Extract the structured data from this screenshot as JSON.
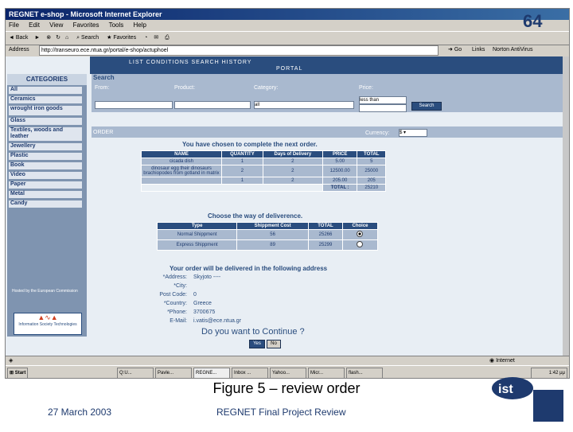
{
  "slide_number": "64",
  "browser": {
    "title": "REGNET e-shop - Microsoft Internet Explorer",
    "menu": [
      "File",
      "Edit",
      "View",
      "Favorites",
      "Tools",
      "Help"
    ],
    "toolbar": {
      "back": "Back",
      "search": "Search",
      "favorites": "Favorites"
    },
    "address_label": "Address",
    "address_value": "http://transeuro.ece.ntua.gr/portal/e-shop/actuphoel",
    "go_label": "Go",
    "links_label": "Links",
    "norton_label": "Norton AntiVirus",
    "status_right": "Internet"
  },
  "page": {
    "nav_links": "LIST   CONDITIONS   SEARCH   HISTORY",
    "nav_active": "PORTAL",
    "categories_title": "CATEGORIES",
    "categories": [
      "All",
      "Ceramics",
      "wrought iron goods",
      "Glass",
      "Textiles, woods and leather",
      "Jewellery",
      "Plastic",
      "Book",
      "Video",
      "Paper",
      "Metal",
      "Candy"
    ],
    "search": {
      "heading": "Search",
      "labels": {
        "from": "From:",
        "product": "Product:",
        "category": "Category:",
        "price": "Price:"
      },
      "category_value": "all",
      "price_value": "less than",
      "button": "Search"
    },
    "order": {
      "heading": "ORDER",
      "currency_label": "Currency:",
      "currency_value": "$",
      "intro": "You have chosen to complete the next order.",
      "columns": [
        "NAME",
        "QUANTITY",
        "Days of Delivery",
        "PRICE",
        "TOTAL"
      ],
      "rows": [
        [
          "cicada dish",
          "1",
          "2",
          "5.00",
          "5"
        ],
        [
          "dinosaur egg their dinosaurs brachiopodes from gotland in matrix",
          "2",
          "2",
          "12500.00",
          "25000"
        ],
        [
          "",
          "1",
          "2",
          "205.00",
          "205"
        ]
      ],
      "total_label": "TOTAL :",
      "total_value": "25210",
      "delivery_prompt": "Choose the way of deliverence.",
      "delivery_columns": [
        "Type",
        "Shippment Cost",
        "TOTAL",
        "Choice"
      ],
      "delivery_rows": [
        {
          "type": "Normal Shippment",
          "cost": "56",
          "total": "25266",
          "selected": true
        },
        {
          "type": "Express Shippment",
          "cost": "89",
          "total": "25299",
          "selected": false
        }
      ],
      "address_heading": "Your order will be delivered in the following address",
      "address_fields": [
        {
          "label": "*Address:",
          "value": "Skyjoto ----"
        },
        {
          "label": "*City:",
          "value": ""
        },
        {
          "label": "Post Code:",
          "value": "0"
        },
        {
          "label": "*Country:",
          "value": "Greece"
        },
        {
          "label": "*Phone:",
          "value": "3700675"
        },
        {
          "label": "E-Mail:",
          "value": "i.vatis@ece.ntua.gr"
        }
      ],
      "continue_question": "Do you want to Continue ?",
      "yes": "Yes",
      "no": "No"
    },
    "sidebar_badge": "Hosted by the European Commission",
    "sidebar_logo": "Information Society Technologies"
  },
  "taskbar": {
    "start": "Start",
    "tasks": [
      "Q:U...",
      "Pavle...",
      "REGNE...",
      "Inbox ...",
      "Yahoo...",
      "Micr...",
      "flash..."
    ],
    "clock": "1:42 μμ"
  },
  "caption": "Figure 5 –  review order",
  "footer_left": "27 March 2003",
  "footer_center": "REGNET Final Project Review",
  "colors": {
    "navy": "#2a4d7e",
    "panel": "#a9b9cf",
    "page": "#e8eef4"
  }
}
